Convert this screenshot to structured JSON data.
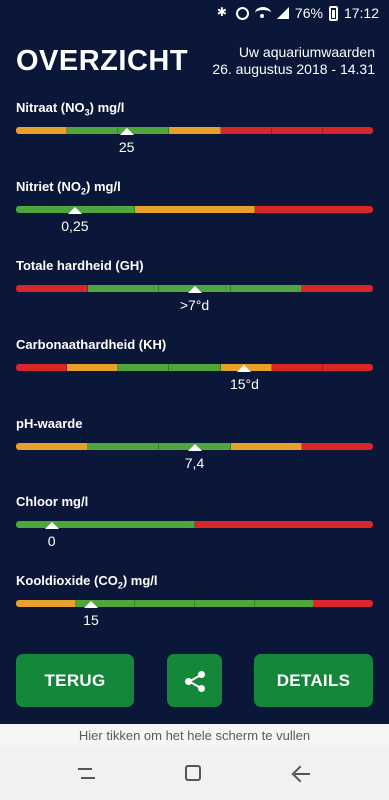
{
  "status": {
    "battery": "76%",
    "time": "17:12"
  },
  "header": {
    "title": "OVERZICHT",
    "subtitle": "Uw aquariumwaarden",
    "datetime": "26. augustus 2018 - 14.31"
  },
  "colors": {
    "green": "#4fa63c",
    "orange": "#e8a02d",
    "red": "#d9262b",
    "button": "#15873b",
    "background": "#0a1738"
  },
  "metrics": [
    {
      "label_pre": "Nitraat (NO",
      "label_sub": "3",
      "label_post": ") mg/l",
      "value": "25",
      "marker": 0.31,
      "segments": [
        "orange",
        "green",
        "green",
        "orange",
        "red",
        "red",
        "red"
      ]
    },
    {
      "label_pre": "Nitriet (NO",
      "label_sub": "2",
      "label_post": ") mg/l",
      "value": "0,25",
      "marker": 0.165,
      "segments": [
        "green",
        "orange",
        "red"
      ]
    },
    {
      "label_pre": "Totale hardheid (GH)",
      "label_sub": "",
      "label_post": "",
      "value": ">7°d",
      "marker": 0.5,
      "segments": [
        "red",
        "green",
        "green",
        "green",
        "red"
      ]
    },
    {
      "label_pre": "Carbonaathardheid (KH)",
      "label_sub": "",
      "label_post": "",
      "value": "15°d",
      "marker": 0.64,
      "segments": [
        "red",
        "orange",
        "green",
        "green",
        "orange",
        "red",
        "red"
      ]
    },
    {
      "label_pre": "pH-waarde",
      "label_sub": "",
      "label_post": "",
      "value": "7,4",
      "marker": 0.5,
      "segments": [
        "orange",
        "green",
        "green",
        "orange",
        "red"
      ]
    },
    {
      "label_pre": "Chloor mg/l",
      "label_sub": "",
      "label_post": "",
      "value": "0",
      "marker": 0.1,
      "segments": [
        "green",
        "red"
      ]
    },
    {
      "label_pre": "Kooldioxide (CO",
      "label_sub": "2",
      "label_post": ") mg/l",
      "value": "15",
      "marker": 0.21,
      "segments": [
        "orange",
        "green",
        "green",
        "green",
        "green",
        "red"
      ]
    }
  ],
  "buttons": {
    "back": "TERUG",
    "details": "DETAILS"
  },
  "fill_hint": "Hier tikken om het hele scherm te vullen"
}
